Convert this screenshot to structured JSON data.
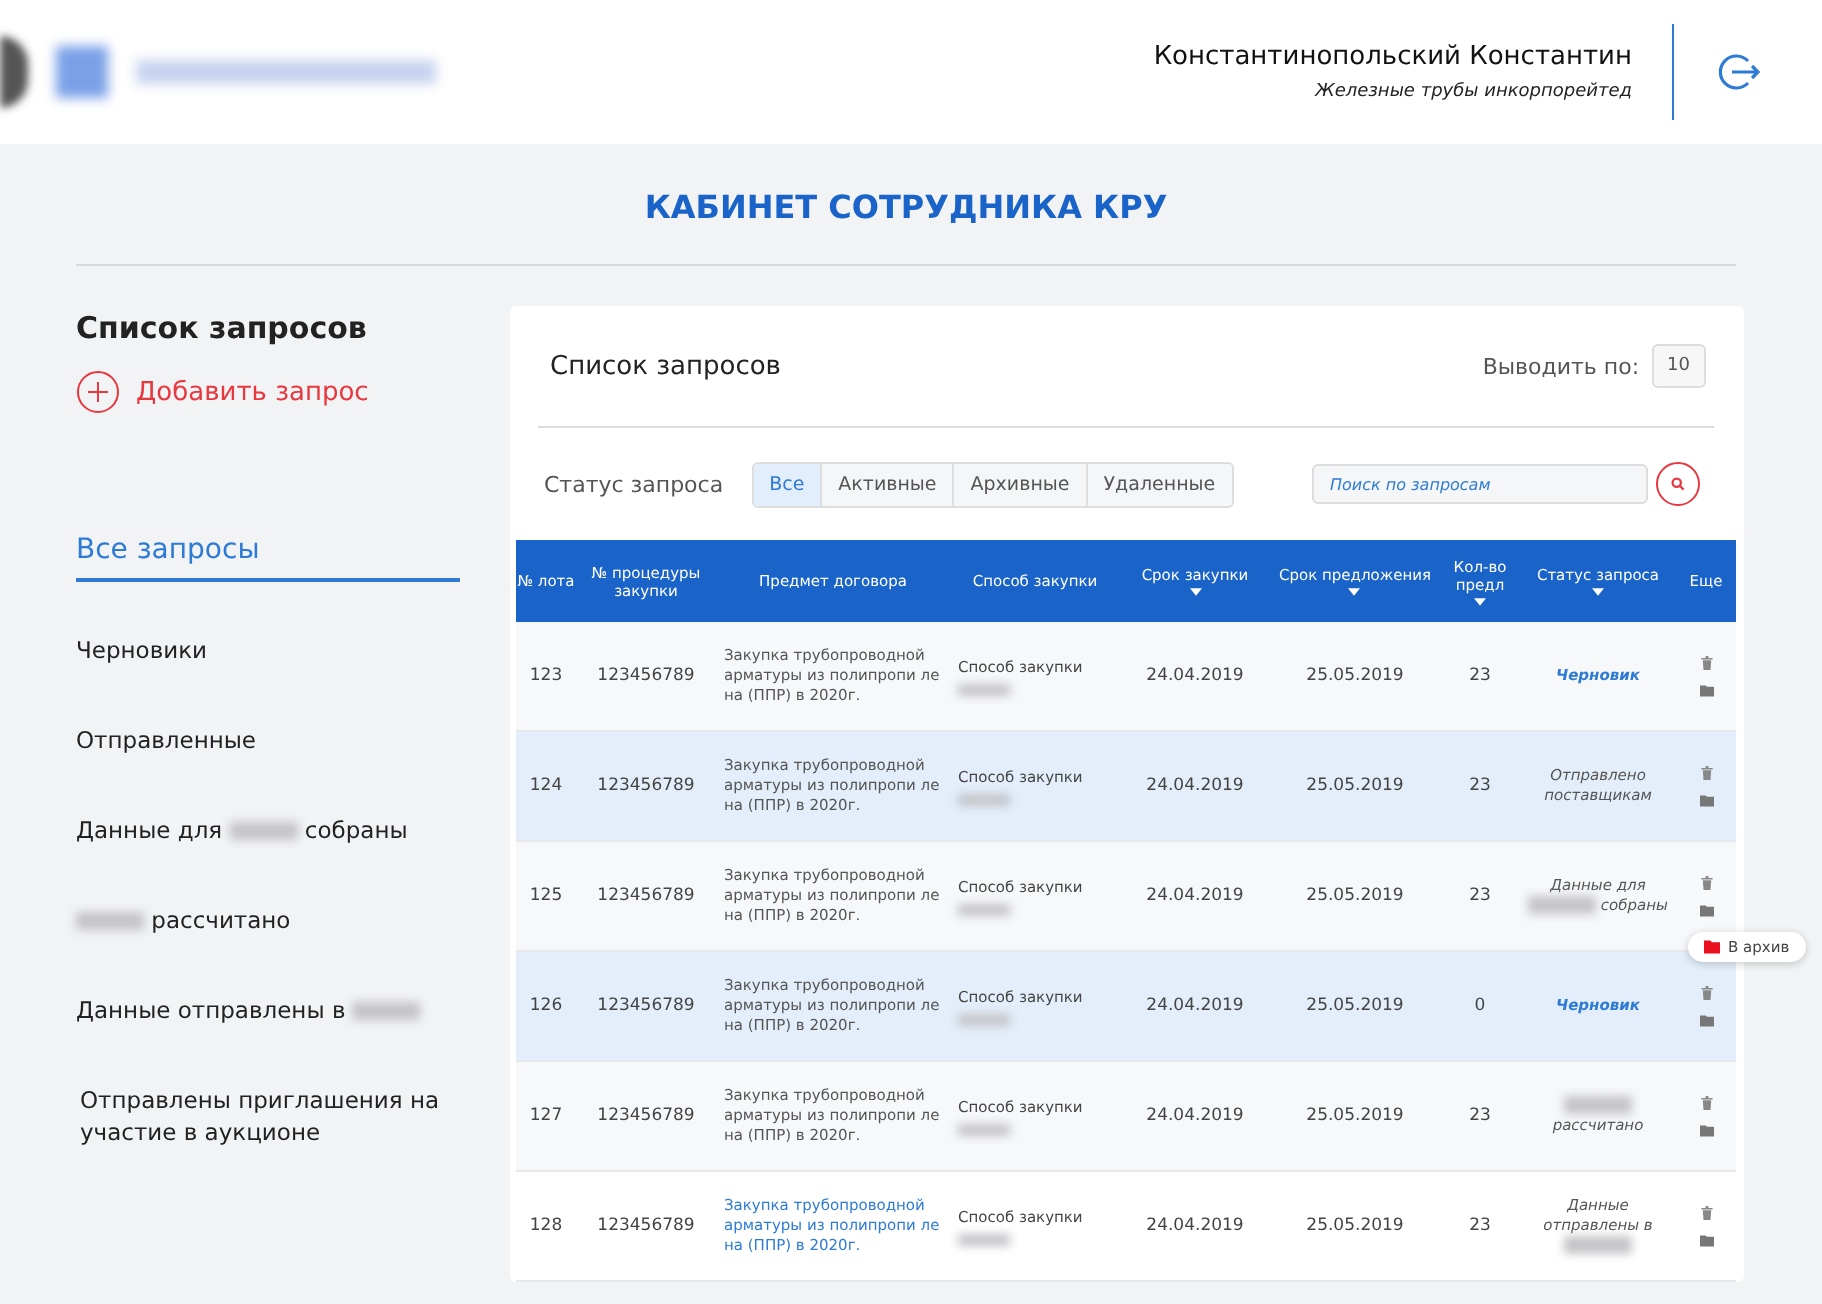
{
  "header": {
    "user_name": "Константинопольский Константин",
    "company": "Железные трубы инкорпорейтед"
  },
  "page_title": "КАБИНЕТ СОТРУДНИКА КРУ",
  "sidebar": {
    "title": "Список запросов",
    "add_label": "Добавить запрос",
    "items": [
      {
        "segments": [
          {
            "kind": "text",
            "text": "Все запросы"
          }
        ],
        "selected": true
      },
      {
        "segments": [
          {
            "kind": "text",
            "text": "Черновики"
          }
        ],
        "selected": false
      },
      {
        "segments": [
          {
            "kind": "text",
            "text": "Отправленные"
          }
        ],
        "selected": false
      },
      {
        "segments": [
          {
            "kind": "text",
            "text": "Данные для"
          },
          {
            "kind": "blur"
          },
          {
            "kind": "text",
            "text": "собраны"
          }
        ],
        "selected": false
      },
      {
        "segments": [
          {
            "kind": "blur"
          },
          {
            "kind": "text",
            "text": "рассчитано"
          }
        ],
        "selected": false
      },
      {
        "segments": [
          {
            "kind": "text",
            "text": "Данные отправлены в"
          },
          {
            "kind": "blur"
          }
        ],
        "selected": false
      },
      {
        "segments": [
          {
            "kind": "text",
            "text": "Отправлены приглашения на участие в аукционе"
          }
        ],
        "selected": false
      }
    ]
  },
  "panel": {
    "title": "Список запросов",
    "page_size_label": "Выводить по:",
    "page_size": "10",
    "status_label": "Статус запроса",
    "filters": [
      {
        "label": "Все",
        "selected": true
      },
      {
        "label": "Активные",
        "selected": false
      },
      {
        "label": "Архивные",
        "selected": false
      },
      {
        "label": "Удаленные",
        "selected": false
      }
    ],
    "search": {
      "placeholder": "Поиск по запросам"
    }
  },
  "table": {
    "columns": [
      {
        "label": "№ лота",
        "sortable": false
      },
      {
        "label": "№ процедуры закупки",
        "sortable": false
      },
      {
        "label": "Предмет договора",
        "sortable": false
      },
      {
        "label": "Способ закупки",
        "sortable": false
      },
      {
        "label": "Срок закупки",
        "sortable": true
      },
      {
        "label": "Срок предложения",
        "sortable": true
      },
      {
        "label": "Кол-во предл",
        "sortable": true
      },
      {
        "label": "Статус запроса",
        "sortable": true
      },
      {
        "label": "Еще",
        "sortable": false
      }
    ],
    "rows": [
      {
        "lot": "123",
        "procedure": "123456789",
        "subject": "Закупка трубопроводной арматуры из полипропи ле на (ППР) в 2020г.",
        "subject_hovered": false,
        "method": "Способ закупки",
        "date_purchase": "24.04.2019",
        "date_offer": "25.05.2019",
        "offers": "23",
        "status": {
          "kind": "link",
          "segments": [
            {
              "kind": "text",
              "text": "Черновик"
            }
          ]
        },
        "selected": false
      },
      {
        "lot": "124",
        "procedure": "123456789",
        "subject": "Закупка трубопроводной арматуры из полипропи ле на (ППР) в 2020г.",
        "subject_hovered": false,
        "method": "Способ закупки",
        "date_purchase": "24.04.2019",
        "date_offer": "25.05.2019",
        "offers": "23",
        "status": {
          "kind": "plain",
          "segments": [
            {
              "kind": "text",
              "text": "Отправлено поставщикам"
            }
          ]
        },
        "selected": true
      },
      {
        "lot": "125",
        "procedure": "123456789",
        "subject": "Закупка трубопроводной арматуры из полипропи ле на (ППР) в 2020г.",
        "subject_hovered": false,
        "method": "Способ закупки",
        "date_purchase": "24.04.2019",
        "date_offer": "25.05.2019",
        "offers": "23",
        "status": {
          "kind": "plain",
          "segments": [
            {
              "kind": "text",
              "text": "Данные для"
            },
            {
              "kind": "blur"
            },
            {
              "kind": "text",
              "text": "собраны"
            }
          ]
        },
        "selected": false,
        "tooltip": "В архив"
      },
      {
        "lot": "126",
        "procedure": "123456789",
        "subject": "Закупка трубопроводной арматуры из полипропи ле на (ППР) в 2020г.",
        "subject_hovered": false,
        "method": "Способ закупки",
        "date_purchase": "24.04.2019",
        "date_offer": "25.05.2019",
        "offers": "0",
        "status": {
          "kind": "link",
          "segments": [
            {
              "kind": "text",
              "text": "Черновик"
            }
          ]
        },
        "selected": true
      },
      {
        "lot": "127",
        "procedure": "123456789",
        "subject": "Закупка трубопроводной арматуры из полипропи ле на (ППР) в 2020г.",
        "subject_hovered": false,
        "method": "Способ закупки",
        "date_purchase": "24.04.2019",
        "date_offer": "25.05.2019",
        "offers": "23",
        "status": {
          "kind": "plain",
          "segments": [
            {
              "kind": "blur"
            },
            {
              "kind": "text",
              "text": "рассчитано"
            }
          ]
        },
        "selected": false
      },
      {
        "lot": "128",
        "procedure": "123456789",
        "subject": "Закупка трубопроводной арматуры из полипропи ле на (ППР) в 2020г.",
        "subject_hovered": true,
        "method": "Способ закупки",
        "date_purchase": "24.04.2019",
        "date_offer": "25.05.2019",
        "offers": "23",
        "status": {
          "kind": "plain",
          "segments": [
            {
              "kind": "text",
              "text": "Данные отправлены в"
            },
            {
              "kind": "blur"
            }
          ]
        },
        "selected": false
      }
    ]
  }
}
